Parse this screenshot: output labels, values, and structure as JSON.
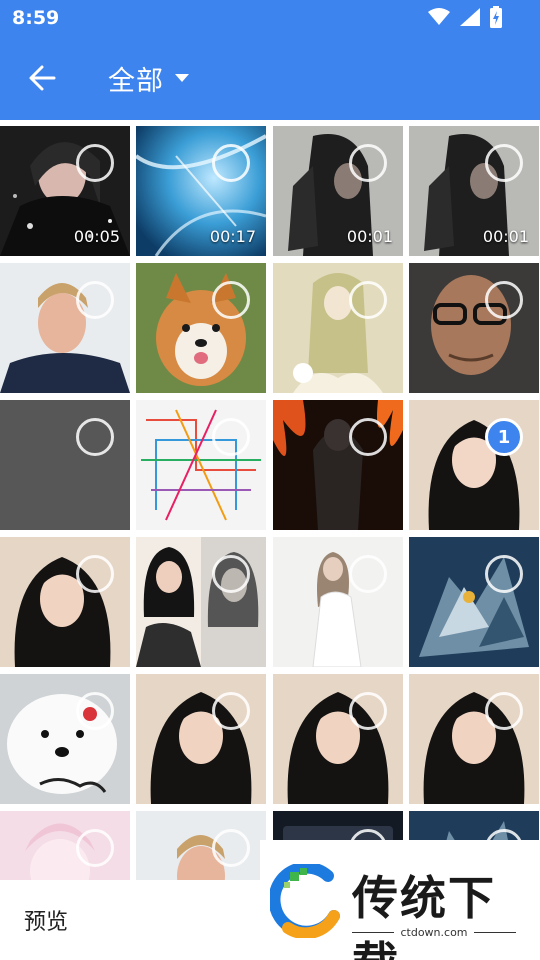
{
  "status_bar": {
    "time": "8:59",
    "icons": [
      "wifi-icon",
      "signal-icon",
      "battery-charging-icon"
    ]
  },
  "app_bar": {
    "back_icon": "arrow-left-icon",
    "album_title": "全部",
    "dropdown_icon": "caret-down-icon"
  },
  "grid": {
    "tiles": [
      {
        "kind": "video",
        "duration": "00:05",
        "selected": false
      },
      {
        "kind": "video",
        "duration": "00:17",
        "selected": false
      },
      {
        "kind": "video",
        "duration": "00:01",
        "selected": false
      },
      {
        "kind": "video",
        "duration": "00:01",
        "selected": false
      },
      {
        "kind": "image",
        "selected": false
      },
      {
        "kind": "image",
        "selected": false
      },
      {
        "kind": "image",
        "selected": false
      },
      {
        "kind": "image",
        "selected": false
      },
      {
        "kind": "image",
        "selected": false
      },
      {
        "kind": "image",
        "selected": false
      },
      {
        "kind": "image",
        "selected": false
      },
      {
        "kind": "image",
        "selected": true,
        "order": "1"
      },
      {
        "kind": "image",
        "selected": false
      },
      {
        "kind": "image",
        "selected": false
      },
      {
        "kind": "image",
        "selected": false
      },
      {
        "kind": "image",
        "selected": false
      },
      {
        "kind": "image",
        "selected": false
      },
      {
        "kind": "image",
        "selected": false
      },
      {
        "kind": "image",
        "selected": false
      },
      {
        "kind": "image",
        "selected": false
      },
      {
        "kind": "image",
        "selected": false
      },
      {
        "kind": "image",
        "selected": false
      },
      {
        "kind": "image",
        "selected": false
      },
      {
        "kind": "image",
        "selected": false
      }
    ]
  },
  "bottom_bar": {
    "preview_label": "预览"
  },
  "watermark": {
    "brand": "传统下载",
    "url": "ctdown.com"
  },
  "colors": {
    "accent": "#3d84ef",
    "check_border": "#ffffff",
    "text": "#222222"
  }
}
